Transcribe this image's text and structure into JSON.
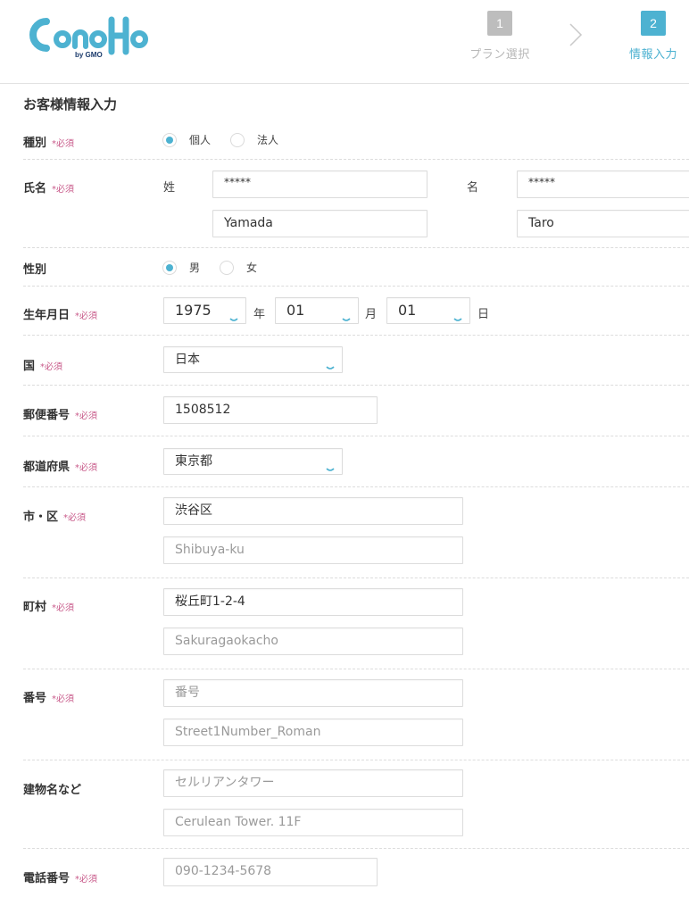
{
  "brand": {
    "name": "ConoHa",
    "sub": "by GMO",
    "color": "#4db2d1"
  },
  "steps": [
    {
      "num": "1",
      "label": "プラン選択",
      "active": false
    },
    {
      "num": "2",
      "label": "情報入力",
      "active": true
    }
  ],
  "page_title": "お客様情報入力",
  "required_mark": "*必須",
  "form": {
    "type": {
      "label": "種別",
      "options": [
        "個人",
        "法人"
      ],
      "selected": "個人"
    },
    "name": {
      "label": "氏名",
      "last_label": "姓",
      "first_label": "名",
      "last_kanji": "*****",
      "first_kanji": "*****",
      "last_roman": "Yamada",
      "first_roman": "Taro"
    },
    "gender": {
      "label": "性別",
      "options": [
        "男",
        "女"
      ],
      "selected": "男"
    },
    "birthdate": {
      "label": "生年月日",
      "year": "1975",
      "year_unit": "年",
      "month": "01",
      "month_unit": "月",
      "day": "01",
      "day_unit": "日"
    },
    "country": {
      "label": "国",
      "value": "日本"
    },
    "postal": {
      "label": "郵便番号",
      "value": "1508512"
    },
    "prefecture": {
      "label": "都道府県",
      "value": "東京都"
    },
    "city": {
      "label": "市・区",
      "value": "渋谷区",
      "roman_placeholder": "Shibuya-ku"
    },
    "town": {
      "label": "町村",
      "value": "桜丘町1-2-4",
      "roman_placeholder": "Sakuragaokacho"
    },
    "number": {
      "label": "番号",
      "placeholder": "番号",
      "roman_placeholder": "Street1Number_Roman"
    },
    "building": {
      "label": "建物名など",
      "placeholder": "セルリアンタワー",
      "roman_placeholder": "Cerulean Tower. 11F"
    },
    "phone": {
      "label": "電話番号",
      "placeholder": "090-1234-5678"
    }
  }
}
